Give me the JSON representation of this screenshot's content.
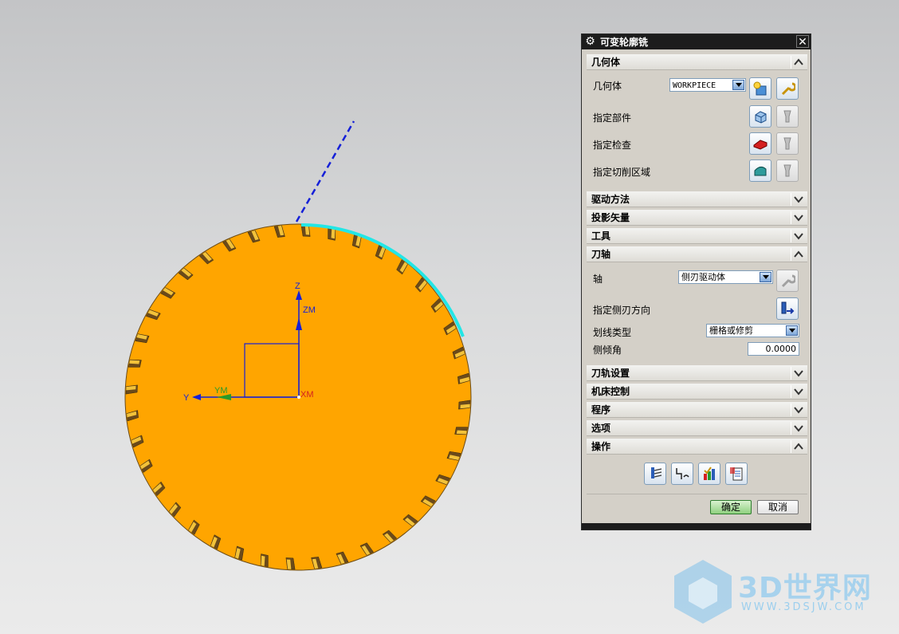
{
  "dialog": {
    "title": "可变轮廓铣",
    "sections": {
      "geometry": "几何体",
      "drive_method": "驱动方法",
      "projection_vector": "投影矢量",
      "tool": "工具",
      "tool_axis": "刀轴",
      "path_settings": "刀轨设置",
      "machine_control": "机床控制",
      "program": "程序",
      "options": "选项",
      "actions": "操作"
    },
    "geometry": {
      "geometry_label": "几何体",
      "geometry_value": "WORKPIECE",
      "specify_part": "指定部件",
      "specify_check": "指定检查",
      "specify_cut_area": "指定切削区域"
    },
    "tool_axis": {
      "axis_label": "轴",
      "axis_value": "侧刃驱动体",
      "side_blade_dir": "指定侧刃方向",
      "ruling_type_label": "划线类型",
      "ruling_type_value": "栅格或修剪",
      "tilt_angle_label": "侧倾角",
      "tilt_angle_value": "0.0000"
    },
    "ok": "确定",
    "cancel": "取消"
  },
  "viewport": {
    "axis_z": "Z",
    "axis_zm": "ZM",
    "axis_y": "Y",
    "axis_ym": "YM",
    "axis_xm": "XM",
    "gear_color": "#ffa500",
    "highlight_color": "#22e6e6",
    "vector_color": "#1520d8"
  },
  "watermark": {
    "brand": "3D世界网",
    "url": "WWW.3DSJW.COM"
  }
}
